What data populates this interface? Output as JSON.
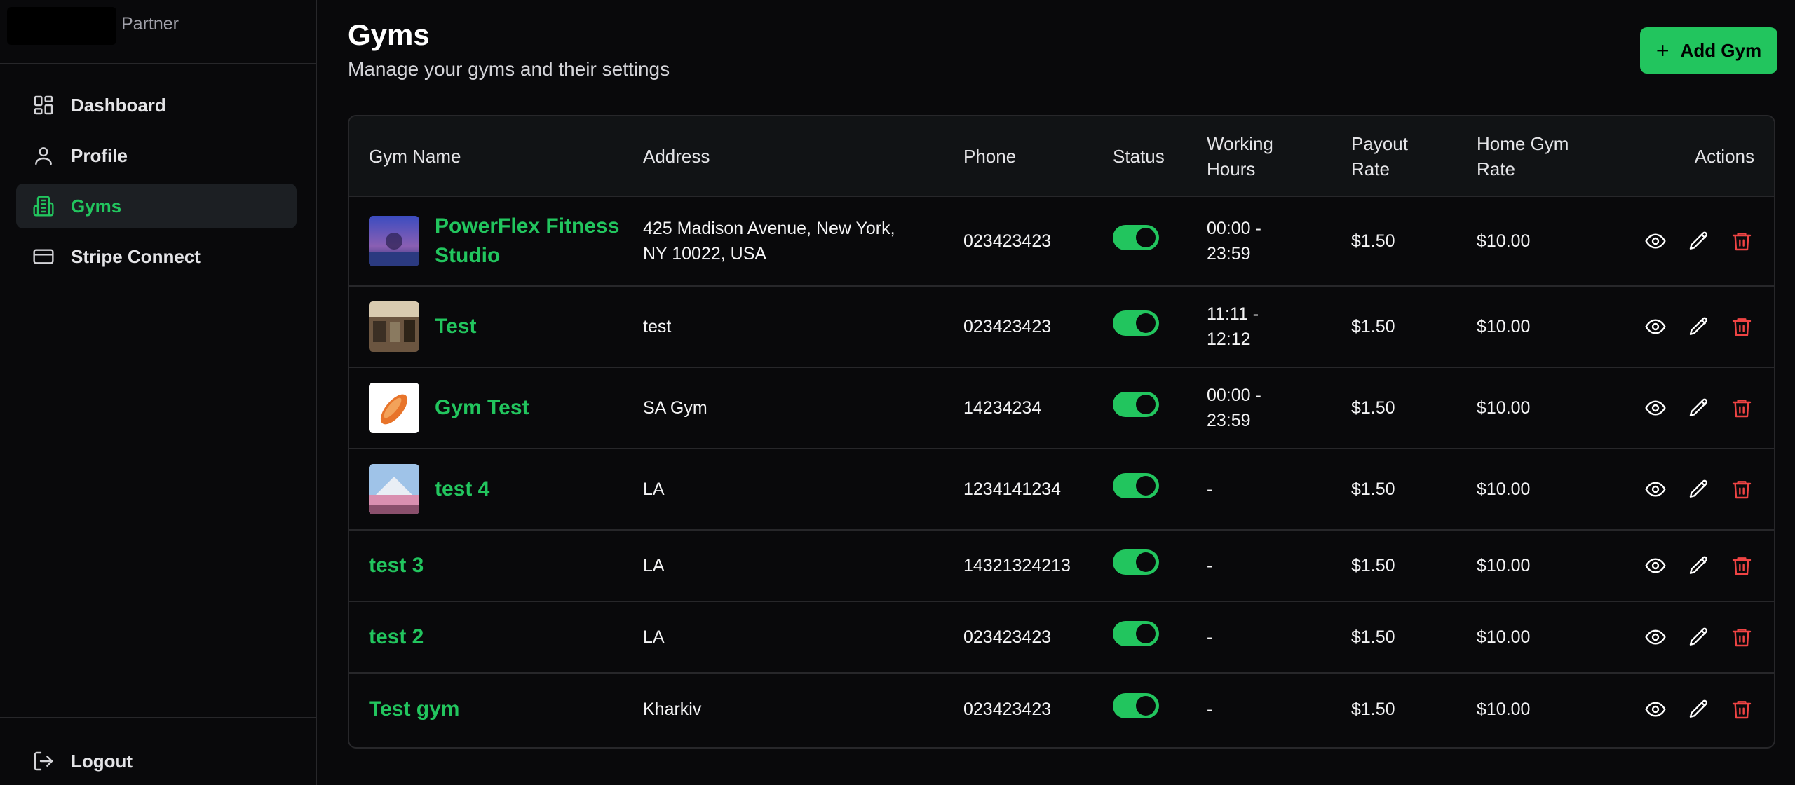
{
  "sidebar": {
    "brand_label": "Partner",
    "items": [
      {
        "label": "Dashboard",
        "icon": "dashboard-icon"
      },
      {
        "label": "Profile",
        "icon": "user-icon"
      },
      {
        "label": "Gyms",
        "icon": "building-icon",
        "active": true
      },
      {
        "label": "Stripe Connect",
        "icon": "credit-card-icon"
      }
    ],
    "logout_label": "Logout"
  },
  "header": {
    "title": "Gyms",
    "subtitle": "Manage your gyms and their settings",
    "add_button_label": "Add Gym"
  },
  "table": {
    "columns": [
      "Gym Name",
      "Address",
      "Phone",
      "Status",
      "Working Hours",
      "Payout Rate",
      "Home Gym Rate",
      "Actions"
    ],
    "rows": [
      {
        "name": "PowerFlex Fitness Studio",
        "address": "425 Madison Avenue, New York, NY 10022, USA",
        "phone": "023423423",
        "status": "active",
        "hours": "00:00 - 23:59",
        "payout": "$1.50",
        "home_rate": "$10.00"
      },
      {
        "name": "Test",
        "address": "test",
        "phone": "023423423",
        "status": "active",
        "hours": "11:11 - 12:12",
        "payout": "$1.50",
        "home_rate": "$10.00"
      },
      {
        "name": "Gym Test",
        "address": "SA Gym",
        "phone": "14234234",
        "status": "active",
        "hours": "00:00 - 23:59",
        "payout": "$1.50",
        "home_rate": "$10.00"
      },
      {
        "name": "test 4",
        "address": "LA",
        "phone": "1234141234",
        "status": "active",
        "hours": "-",
        "payout": "$1.50",
        "home_rate": "$10.00"
      },
      {
        "name": "test 3",
        "address": "LA",
        "phone": "14321324213",
        "status": "active",
        "hours": "-",
        "payout": "$1.50",
        "home_rate": "$10.00"
      },
      {
        "name": "test 2",
        "address": "LA",
        "phone": "023423423",
        "status": "active",
        "hours": "-",
        "payout": "$1.50",
        "home_rate": "$10.00"
      },
      {
        "name": "Test gym",
        "address": "Kharkiv",
        "phone": "023423423",
        "status": "active",
        "hours": "-",
        "payout": "$1.50",
        "home_rate": "$10.00"
      }
    ]
  },
  "colors": {
    "accent": "#22c55e",
    "danger": "#ef4444",
    "background": "#09090b",
    "border": "#27272a"
  }
}
